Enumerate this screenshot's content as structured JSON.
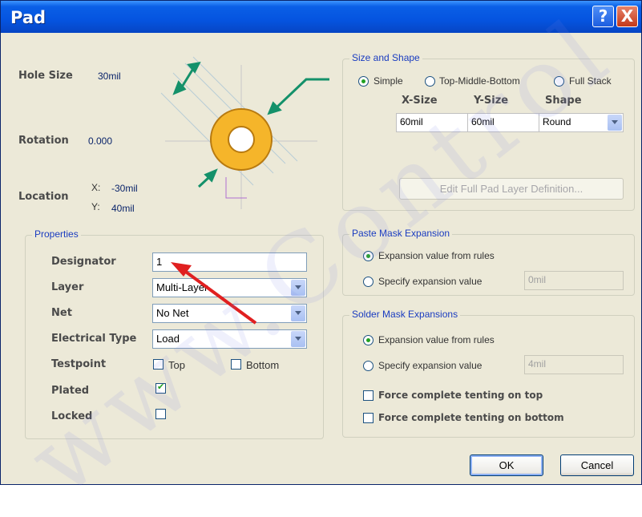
{
  "window": {
    "title": "Pad",
    "help_label": "?",
    "close_label": "X"
  },
  "pad_info": {
    "hole_size_label": "Hole Size",
    "hole_size_value": "30mil",
    "rotation_label": "Rotation",
    "rotation_value": "0.000",
    "location_label": "Location",
    "x_label": "X:",
    "x_value": "-30mil",
    "y_label": "Y:",
    "y_value": "40mil"
  },
  "size_shape": {
    "legend": "Size and Shape",
    "modes": [
      {
        "label": "Simple",
        "selected": true
      },
      {
        "label": "Top-Middle-Bottom",
        "selected": false
      },
      {
        "label": "Full Stack",
        "selected": false
      }
    ],
    "columns": [
      "X-Size",
      "Y-Size",
      "Shape"
    ],
    "row": {
      "x_size": "60mil",
      "y_size": "60mil",
      "shape": "Round"
    },
    "edit_button": "Edit Full Pad Layer Definition..."
  },
  "properties": {
    "legend": "Properties",
    "designator_label": "Designator",
    "designator_value": "1",
    "layer_label": "Layer",
    "layer_value": "Multi-Layer",
    "net_label": "Net",
    "net_value": "No Net",
    "electrical_type_label": "Electrical Type",
    "electrical_type_value": "Load",
    "testpoint_label": "Testpoint",
    "testpoint_top": "Top",
    "testpoint_bottom": "Bottom",
    "plated_label": "Plated",
    "plated_checked": true,
    "locked_label": "Locked",
    "locked_checked": false
  },
  "paste_mask": {
    "legend": "Paste Mask Expansion",
    "from_rules": "Expansion value from rules",
    "specify": "Specify expansion value",
    "specify_value": "0mil"
  },
  "solder_mask": {
    "legend": "Solder Mask Expansions",
    "from_rules": "Expansion value from rules",
    "specify": "Specify expansion value",
    "specify_value": "4mil",
    "tent_top": "Force complete tenting on top",
    "tent_bottom": "Force complete tenting on bottom"
  },
  "buttons": {
    "ok": "OK",
    "cancel": "Cancel"
  },
  "colors": {
    "pad_ring": "#f5b52a",
    "arrow_green": "#14916a",
    "annotation_red": "#e02020",
    "legend_blue": "#1a3cc0"
  },
  "watermark": "www.Control"
}
